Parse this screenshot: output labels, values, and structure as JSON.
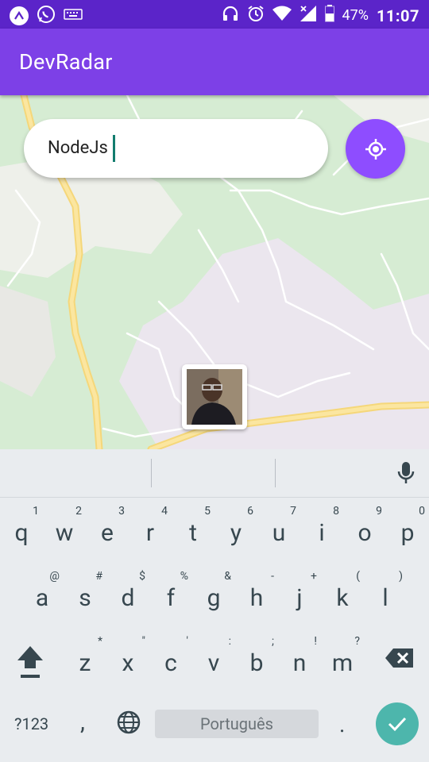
{
  "status_bar": {
    "battery": "47%",
    "time": "11:07",
    "left_icons": [
      "app-icon",
      "whatsapp-icon",
      "keyboard-icon"
    ],
    "right_icons": [
      "headphones-icon",
      "alarm-icon",
      "wifi-icon",
      "signal-icon",
      "battery-icon"
    ]
  },
  "app": {
    "title": "DevRadar",
    "accent": "#7d40e7",
    "statusbar_color": "#5b24c9"
  },
  "search": {
    "value": "NodeJs"
  },
  "locate_button": {
    "icon": "gps-fixed-icon",
    "color": "#8e4dff"
  },
  "map": {
    "marker": {
      "icon": "developer-avatar"
    }
  },
  "keyboard": {
    "row1": [
      {
        "key": "q",
        "alt": "1"
      },
      {
        "key": "w",
        "alt": "2"
      },
      {
        "key": "e",
        "alt": "3"
      },
      {
        "key": "r",
        "alt": "4"
      },
      {
        "key": "t",
        "alt": "5"
      },
      {
        "key": "y",
        "alt": "6"
      },
      {
        "key": "u",
        "alt": "7"
      },
      {
        "key": "i",
        "alt": "8"
      },
      {
        "key": "o",
        "alt": "9"
      },
      {
        "key": "p",
        "alt": "0"
      }
    ],
    "row2": [
      {
        "key": "a",
        "alt": "@"
      },
      {
        "key": "s",
        "alt": "#"
      },
      {
        "key": "d",
        "alt": "$"
      },
      {
        "key": "f",
        "alt": "%"
      },
      {
        "key": "g",
        "alt": "&"
      },
      {
        "key": "h",
        "alt": "-"
      },
      {
        "key": "j",
        "alt": "+"
      },
      {
        "key": "k",
        "alt": "("
      },
      {
        "key": "l",
        "alt": ")"
      }
    ],
    "row3": [
      {
        "key": "z",
        "alt": "*"
      },
      {
        "key": "x",
        "alt": "\""
      },
      {
        "key": "c",
        "alt": "'"
      },
      {
        "key": "v",
        "alt": ":"
      },
      {
        "key": "b",
        "alt": ";"
      },
      {
        "key": "n",
        "alt": "!"
      },
      {
        "key": "m",
        "alt": "?"
      }
    ],
    "symbols_label": "?123",
    "comma": ",",
    "space_label": "Português",
    "period": ".",
    "enter_color": "#4db6ac"
  }
}
